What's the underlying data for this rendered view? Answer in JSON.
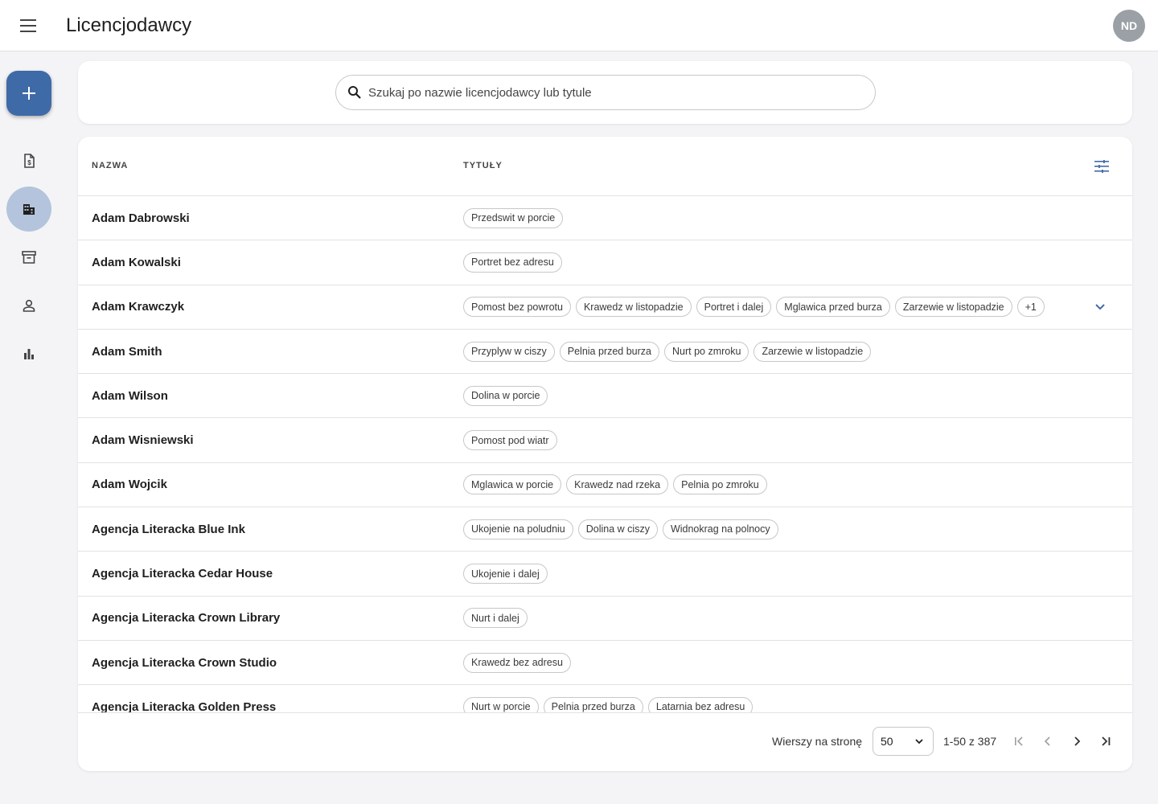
{
  "header": {
    "title": "Licencjodawcy",
    "avatar_initials": "ND"
  },
  "rail": {
    "fab_icon": "plus-icon",
    "items": [
      {
        "icon": "invoice-icon",
        "active": false
      },
      {
        "icon": "buildings-icon",
        "active": true
      },
      {
        "icon": "archive-icon",
        "active": false
      },
      {
        "icon": "person-icon",
        "active": false
      },
      {
        "icon": "bar-chart-icon",
        "active": false
      }
    ]
  },
  "search": {
    "placeholder": "Szukaj po nazwie licencjodawcy lub tytule"
  },
  "table": {
    "col_name": "NAZWA",
    "col_titles": "TYTUŁY",
    "rows": [
      {
        "name": "Adam Dabrowski",
        "titles": [
          "Przedswit w porcie"
        ]
      },
      {
        "name": "Adam Kowalski",
        "titles": [
          "Portret bez adresu"
        ]
      },
      {
        "name": "Adam Krawczyk",
        "titles": [
          "Pomost bez powrotu",
          "Krawedz w listopadzie",
          "Portret i dalej",
          "Mglawica przed burza",
          "Zarzewie w listopadzie",
          "+1"
        ]
      },
      {
        "name": "Adam Smith",
        "titles": [
          "Przyplyw w ciszy",
          "Pelnia przed burza",
          "Nurt po zmroku",
          "Zarzewie w listopadzie"
        ]
      },
      {
        "name": "Adam Wilson",
        "titles": [
          "Dolina w porcie"
        ]
      },
      {
        "name": "Adam Wisniewski",
        "titles": [
          "Pomost pod wiatr"
        ]
      },
      {
        "name": "Adam Wojcik",
        "titles": [
          "Mglawica w porcie",
          "Krawedz nad rzeka",
          "Pelnia po zmroku"
        ]
      },
      {
        "name": "Agencja Literacka Blue Ink",
        "titles": [
          "Ukojenie na poludniu",
          "Dolina w ciszy",
          "Widnokrag na polnocy"
        ]
      },
      {
        "name": "Agencja Literacka Cedar House",
        "titles": [
          "Ukojenie i dalej"
        ]
      },
      {
        "name": "Agencja Literacka Crown Library",
        "titles": [
          "Nurt i dalej"
        ]
      },
      {
        "name": "Agencja Literacka Crown Studio",
        "titles": [
          "Krawedz bez adresu"
        ]
      },
      {
        "name": "Agencja Literacka Golden Press",
        "titles": [
          "Nurt w porcie",
          "Pelnia przed burza",
          "Latarnia bez adresu"
        ]
      }
    ]
  },
  "footer": {
    "rows_per_page_label": "Wierszy na stronę",
    "rows_per_page_value": "50",
    "range_text": "1-50 z 387"
  },
  "colors": {
    "accent": "#3f6aa8",
    "rail_active": "#b3c4dc",
    "avatar_bg": "#9aa0a6"
  }
}
